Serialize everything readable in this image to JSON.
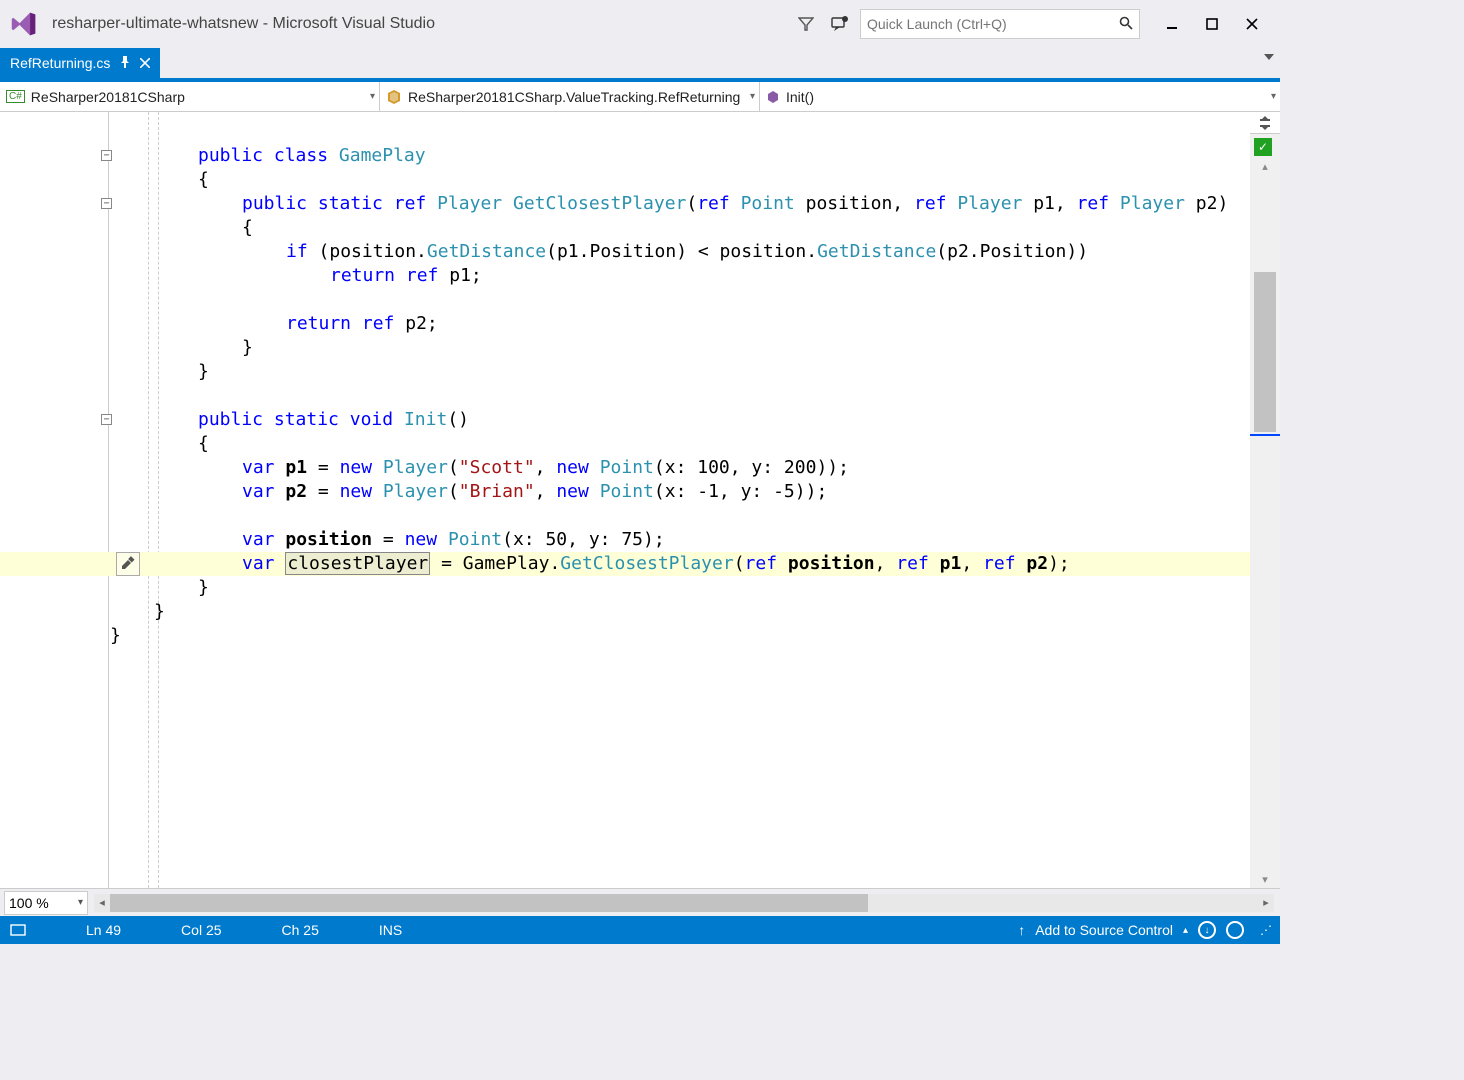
{
  "window": {
    "title": "resharper-ultimate-whatsnew - Microsoft Visual Studio",
    "quick_launch_placeholder": "Quick Launch (Ctrl+Q)"
  },
  "document_tab": {
    "filename": "RefReturning.cs"
  },
  "nav": {
    "scope": "ReSharper20181CSharp",
    "type": "ReSharper20181CSharp.ValueTracking.RefReturning",
    "member": "Init()"
  },
  "code": {
    "lines": [
      {
        "indent": 2,
        "tokens": []
      },
      {
        "indent": 2,
        "tokens": [
          {
            "t": "public",
            "c": "kw"
          },
          {
            "t": " "
          },
          {
            "t": "class",
            "c": "kw"
          },
          {
            "t": " "
          },
          {
            "t": "GamePlay",
            "c": "typ"
          }
        ],
        "fold": "minus"
      },
      {
        "indent": 2,
        "tokens": [
          {
            "t": "{"
          }
        ]
      },
      {
        "indent": 3,
        "tokens": [
          {
            "t": "public",
            "c": "kw"
          },
          {
            "t": " "
          },
          {
            "t": "static",
            "c": "kw"
          },
          {
            "t": " "
          },
          {
            "t": "ref",
            "c": "kw"
          },
          {
            "t": " "
          },
          {
            "t": "Player",
            "c": "typ"
          },
          {
            "t": " "
          },
          {
            "t": "GetClosestPlayer",
            "c": "mth"
          },
          {
            "t": "("
          },
          {
            "t": "ref",
            "c": "kw"
          },
          {
            "t": " "
          },
          {
            "t": "Point",
            "c": "typ"
          },
          {
            "t": " position, "
          },
          {
            "t": "ref",
            "c": "kw"
          },
          {
            "t": " "
          },
          {
            "t": "Player",
            "c": "typ"
          },
          {
            "t": " p1, "
          },
          {
            "t": "ref",
            "c": "kw"
          },
          {
            "t": " "
          },
          {
            "t": "Player",
            "c": "typ"
          },
          {
            "t": " p2)"
          }
        ],
        "fold": "minus"
      },
      {
        "indent": 3,
        "tokens": [
          {
            "t": "{"
          }
        ]
      },
      {
        "indent": 4,
        "tokens": [
          {
            "t": "if",
            "c": "kw"
          },
          {
            "t": " (position."
          },
          {
            "t": "GetDistance",
            "c": "mth"
          },
          {
            "t": "(p1."
          },
          {
            "t": "Position",
            "c": "ident"
          },
          {
            "t": ") < position."
          },
          {
            "t": "GetDistance",
            "c": "mth"
          },
          {
            "t": "(p2."
          },
          {
            "t": "Position",
            "c": "ident"
          },
          {
            "t": "))"
          }
        ]
      },
      {
        "indent": 5,
        "tokens": [
          {
            "t": "return",
            "c": "kw"
          },
          {
            "t": " "
          },
          {
            "t": "ref",
            "c": "kw"
          },
          {
            "t": " p1;"
          }
        ]
      },
      {
        "indent": 3,
        "tokens": []
      },
      {
        "indent": 4,
        "tokens": [
          {
            "t": "return",
            "c": "kw"
          },
          {
            "t": " "
          },
          {
            "t": "ref",
            "c": "kw"
          },
          {
            "t": " p2;"
          }
        ]
      },
      {
        "indent": 3,
        "tokens": [
          {
            "t": "}"
          }
        ]
      },
      {
        "indent": 2,
        "tokens": [
          {
            "t": "}"
          }
        ]
      },
      {
        "indent": 2,
        "tokens": []
      },
      {
        "indent": 2,
        "tokens": [
          {
            "t": "public",
            "c": "kw"
          },
          {
            "t": " "
          },
          {
            "t": "static",
            "c": "kw"
          },
          {
            "t": " "
          },
          {
            "t": "void",
            "c": "kw"
          },
          {
            "t": " "
          },
          {
            "t": "Init",
            "c": "mth"
          },
          {
            "t": "()"
          }
        ],
        "fold": "minus"
      },
      {
        "indent": 2,
        "tokens": [
          {
            "t": "{"
          }
        ]
      },
      {
        "indent": 3,
        "tokens": [
          {
            "t": "var",
            "c": "kw"
          },
          {
            "t": " "
          },
          {
            "t": "p1",
            "c": "bold"
          },
          {
            "t": " = "
          },
          {
            "t": "new",
            "c": "kw"
          },
          {
            "t": " "
          },
          {
            "t": "Player",
            "c": "typ"
          },
          {
            "t": "("
          },
          {
            "t": "\"Scott\"",
            "c": "str"
          },
          {
            "t": ", "
          },
          {
            "t": "new",
            "c": "kw"
          },
          {
            "t": " "
          },
          {
            "t": "Point",
            "c": "typ"
          },
          {
            "t": "(x: 100, y: 200));"
          }
        ]
      },
      {
        "indent": 3,
        "tokens": [
          {
            "t": "var",
            "c": "kw"
          },
          {
            "t": " "
          },
          {
            "t": "p2",
            "c": "bold"
          },
          {
            "t": " = "
          },
          {
            "t": "new",
            "c": "kw"
          },
          {
            "t": " "
          },
          {
            "t": "Player",
            "c": "typ"
          },
          {
            "t": "("
          },
          {
            "t": "\"Brian\"",
            "c": "str"
          },
          {
            "t": ", "
          },
          {
            "t": "new",
            "c": "kw"
          },
          {
            "t": " "
          },
          {
            "t": "Point",
            "c": "typ"
          },
          {
            "t": "(x: -1, y: -5));"
          }
        ]
      },
      {
        "indent": 3,
        "tokens": []
      },
      {
        "indent": 3,
        "tokens": [
          {
            "t": "var",
            "c": "kw"
          },
          {
            "t": " "
          },
          {
            "t": "position",
            "c": "bold"
          },
          {
            "t": " = "
          },
          {
            "t": "new",
            "c": "kw"
          },
          {
            "t": " "
          },
          {
            "t": "Point",
            "c": "typ"
          },
          {
            "t": "(x: 50, y: 75);"
          }
        ]
      },
      {
        "indent": 3,
        "hl": true,
        "hammer": true,
        "tokens": [
          {
            "t": "var",
            "c": "kw"
          },
          {
            "t": " "
          },
          {
            "t": "closestPlayer",
            "c": "box-var"
          },
          {
            "t": " = GamePlay."
          },
          {
            "t": "GetClosestPlayer",
            "c": "mth"
          },
          {
            "t": "("
          },
          {
            "t": "ref",
            "c": "kw"
          },
          {
            "t": " "
          },
          {
            "t": "position",
            "c": "bold"
          },
          {
            "t": ", "
          },
          {
            "t": "ref",
            "c": "kw"
          },
          {
            "t": " "
          },
          {
            "t": "p1",
            "c": "bold"
          },
          {
            "t": ", "
          },
          {
            "t": "ref",
            "c": "kw"
          },
          {
            "t": " "
          },
          {
            "t": "p2",
            "c": "bold"
          },
          {
            "t": ");"
          }
        ]
      },
      {
        "indent": 2,
        "tokens": [
          {
            "t": "}"
          }
        ]
      },
      {
        "indent": 1,
        "tokens": [
          {
            "t": "}"
          }
        ]
      },
      {
        "indent": 0,
        "tokens": [
          {
            "t": "}"
          }
        ]
      }
    ]
  },
  "zoom": "100 %",
  "status": {
    "ln": "Ln 49",
    "col": "Col 25",
    "ch": "Ch 25",
    "ins": "INS",
    "source_control": "Add to Source Control"
  }
}
